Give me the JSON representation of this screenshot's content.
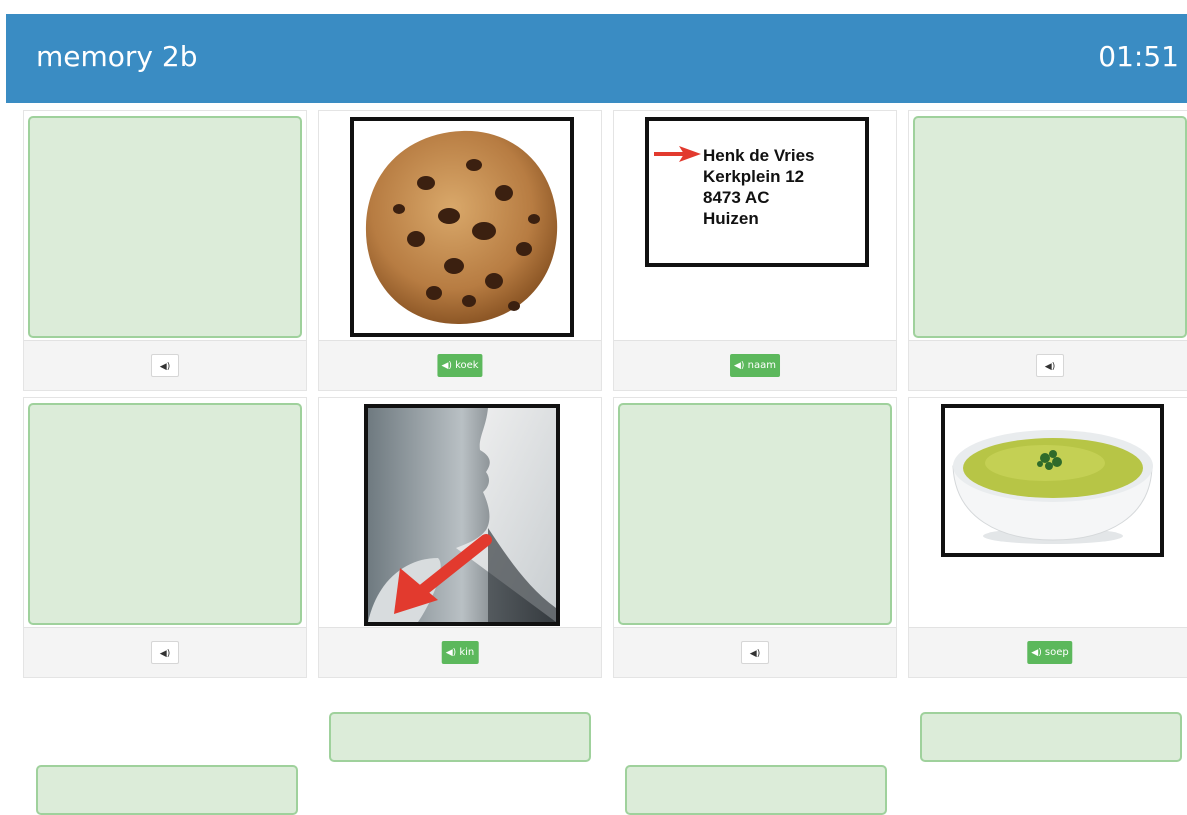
{
  "header": {
    "title": "memory 2b",
    "timer": "01:51"
  },
  "colors": {
    "header": "#3a8cc3",
    "card_back": "#dcecd9",
    "card_border": "#9fd19c",
    "button_green": "#5cb85c"
  },
  "cards": [
    {
      "state": "hidden",
      "label": ""
    },
    {
      "state": "revealed",
      "image": "cookie",
      "label": "koek"
    },
    {
      "state": "revealed",
      "image": "address-label",
      "label": "naam",
      "address_lines": [
        "Henk de Vries",
        "Kerkplein 12",
        "8473 AC",
        "Huizen"
      ]
    },
    {
      "state": "hidden",
      "label": ""
    },
    {
      "state": "hidden",
      "label": ""
    },
    {
      "state": "revealed",
      "image": "chin",
      "label": "kin"
    },
    {
      "state": "hidden",
      "label": ""
    },
    {
      "state": "revealed",
      "image": "soup",
      "label": "soep"
    }
  ],
  "speaker_icon": "speaker-icon",
  "speaker_glyph": "◀)",
  "answer_slots_count": 4
}
